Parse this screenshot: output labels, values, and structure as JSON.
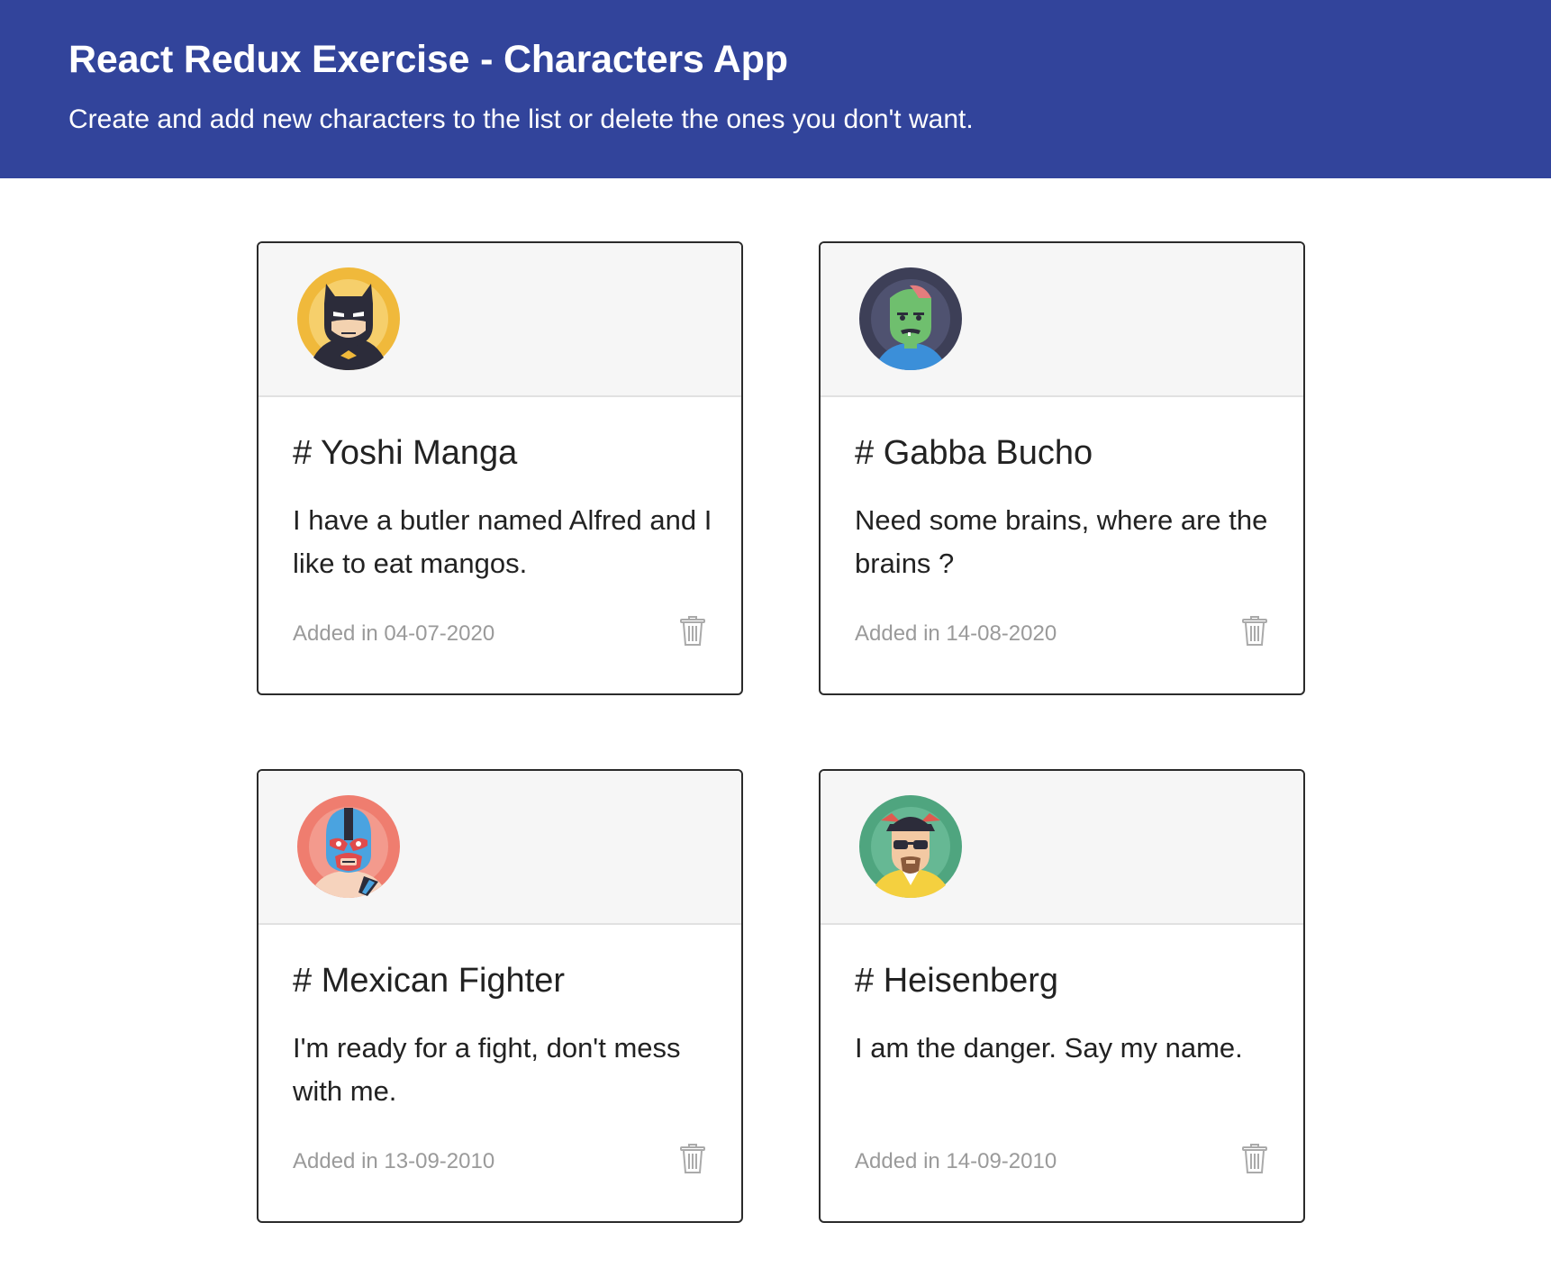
{
  "header": {
    "title": "React Redux Exercise - Characters App",
    "subtitle": "Create and add new characters to the list or delete the ones you don't want.",
    "background_color": "#32449b"
  },
  "characters": [
    {
      "name": "# Yoshi Manga",
      "description": "I have a butler named Alfred and I like to eat mangos.",
      "date": "Added in 04-07-2020",
      "avatar_icon": "batman-avatar-icon"
    },
    {
      "name": "# Gabba Bucho",
      "description": "Need some brains, where are the brains ?",
      "date": "Added in 14-08-2020",
      "avatar_icon": "zombie-avatar-icon"
    },
    {
      "name": "# Mexican Fighter",
      "description": "I'm ready for a fight, don't mess with me.",
      "date": "Added in 13-09-2010",
      "avatar_icon": "luchador-avatar-icon"
    },
    {
      "name": "# Heisenberg",
      "description": "I am the danger. Say my name.",
      "date": "Added in 14-09-2010",
      "avatar_icon": "heisenberg-avatar-icon"
    }
  ]
}
